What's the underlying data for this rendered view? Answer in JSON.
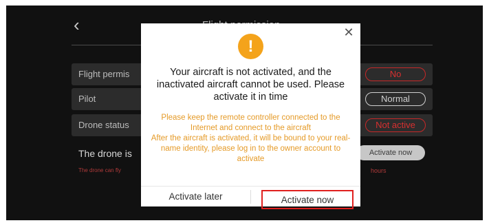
{
  "background": {
    "back_icon": "chevron-left-icon",
    "title": "Flight permission",
    "rows": [
      {
        "label": "Flight permis",
        "status": "No"
      },
      {
        "label": "Pilot",
        "status": "Normal"
      },
      {
        "label": "Drone status",
        "status": "Not active"
      }
    ],
    "drone_text": "The drone is",
    "drone_sub": "The drone can fly",
    "drone_sub_right": "hours",
    "activate_button": "Activate now"
  },
  "modal": {
    "close_icon": "close-icon",
    "warning_icon": "warning-icon",
    "warning_glyph": "!",
    "message": "Your aircraft is not activated, and the inactivated aircraft cannot be used. Please activate it in time",
    "details": [
      "Please keep the remote controller connected to the Internet and connect to the aircraft",
      "After the aircraft is activated, it will be bound to your real-name identity, please log in to the owner account to activate"
    ],
    "later_label": "Activate later",
    "now_label": "Activate now"
  },
  "colors": {
    "accent": "#f4a31b",
    "detail_text": "#e59a27",
    "highlight": "#e0201e",
    "status_red": "#c82828"
  }
}
